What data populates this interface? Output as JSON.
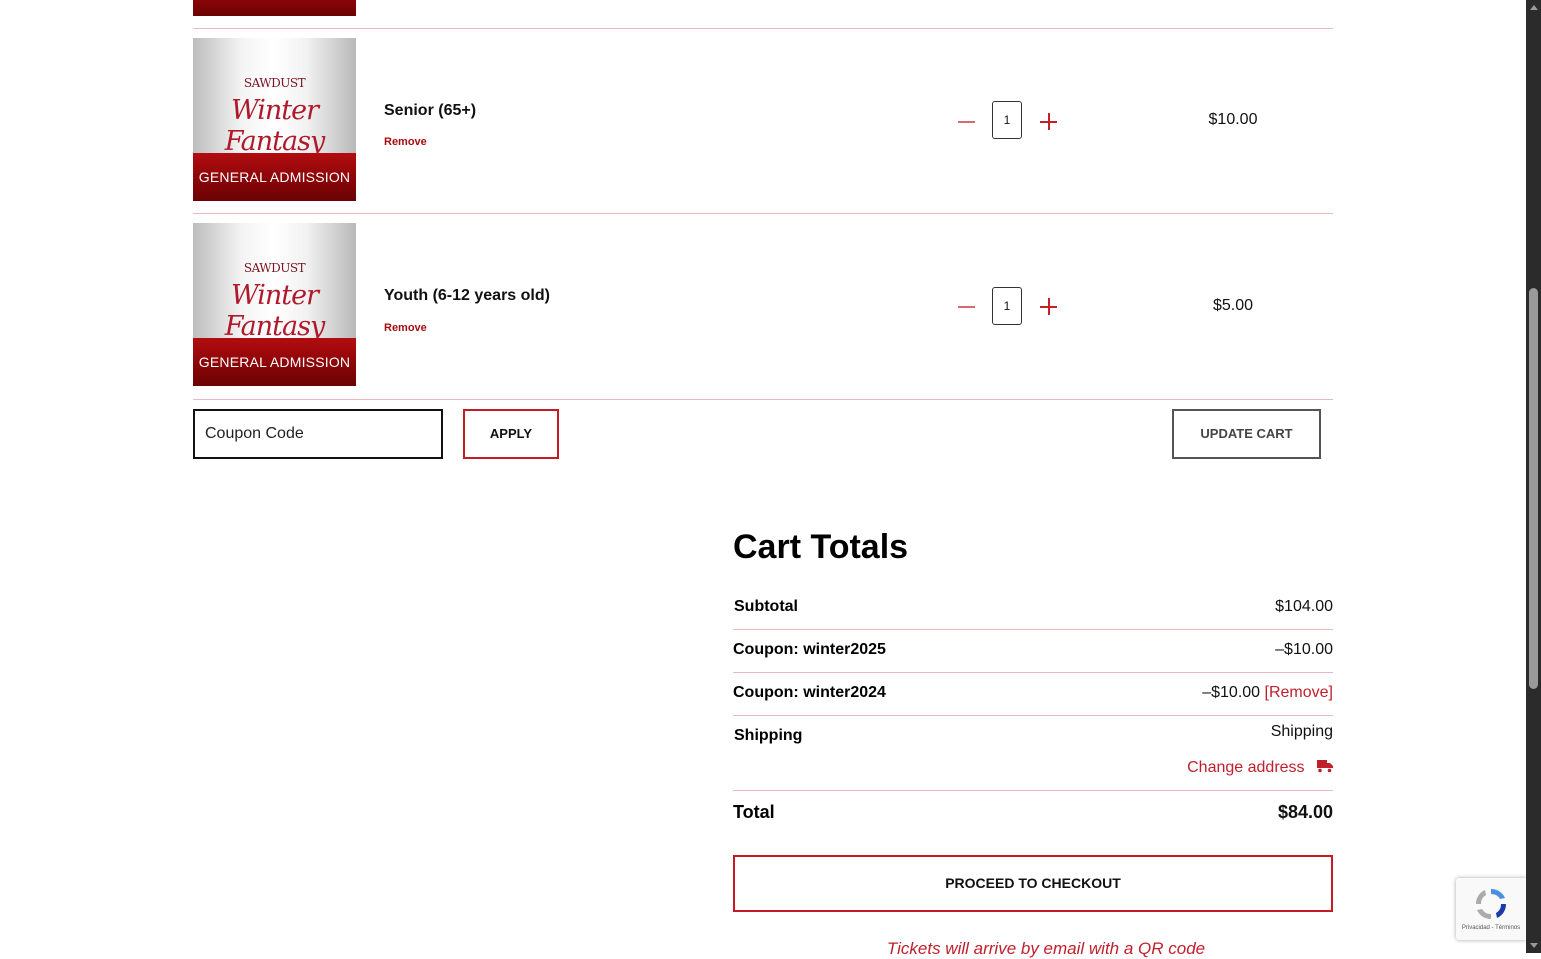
{
  "cart_items": [
    {
      "thumb_brand_top": "SAWDUST",
      "thumb_brand_script": "Winter Fantasy",
      "thumb_banner": "GENERAL ADMISSION",
      "name": "Senior (65+)",
      "remove_label": "Remove",
      "quantity": "1",
      "price": "$10.00"
    },
    {
      "thumb_brand_top": "SAWDUST",
      "thumb_brand_script": "Winter Fantasy",
      "thumb_banner": "GENERAL ADMISSION",
      "name": "Youth (6-12 years old)",
      "remove_label": "Remove",
      "quantity": "1",
      "price": "$5.00"
    }
  ],
  "coupon": {
    "placeholder": "Coupon Code",
    "apply_label": "APPLY"
  },
  "update_cart_label": "UPDATE CART",
  "cart_totals": {
    "title": "Cart Totals",
    "subtotal_label": "Subtotal",
    "subtotal_value": "$104.00",
    "coupons": [
      {
        "label": "Coupon: winter2025",
        "value": "–$10.00",
        "remove": ""
      },
      {
        "label": "Coupon: winter2024",
        "value": "–$10.00",
        "remove": "[Remove]"
      }
    ],
    "shipping_label": "Shipping",
    "shipping_value": "Shipping",
    "change_address": "Change address",
    "total_label": "Total",
    "total_value": "$84.00",
    "checkout_label": "PROCEED TO CHECKOUT",
    "note": "Tickets will arrive by email with a QR code"
  },
  "recaptcha": {
    "text": "Privacidad - Términos"
  },
  "colors": {
    "accent": "#c61a24",
    "divider": "#e8b9c2",
    "banner": "#8a0508"
  },
  "icons": {
    "shipping_truck": "truck-icon",
    "qty_minus": "minus-icon",
    "qty_plus": "plus-icon"
  }
}
